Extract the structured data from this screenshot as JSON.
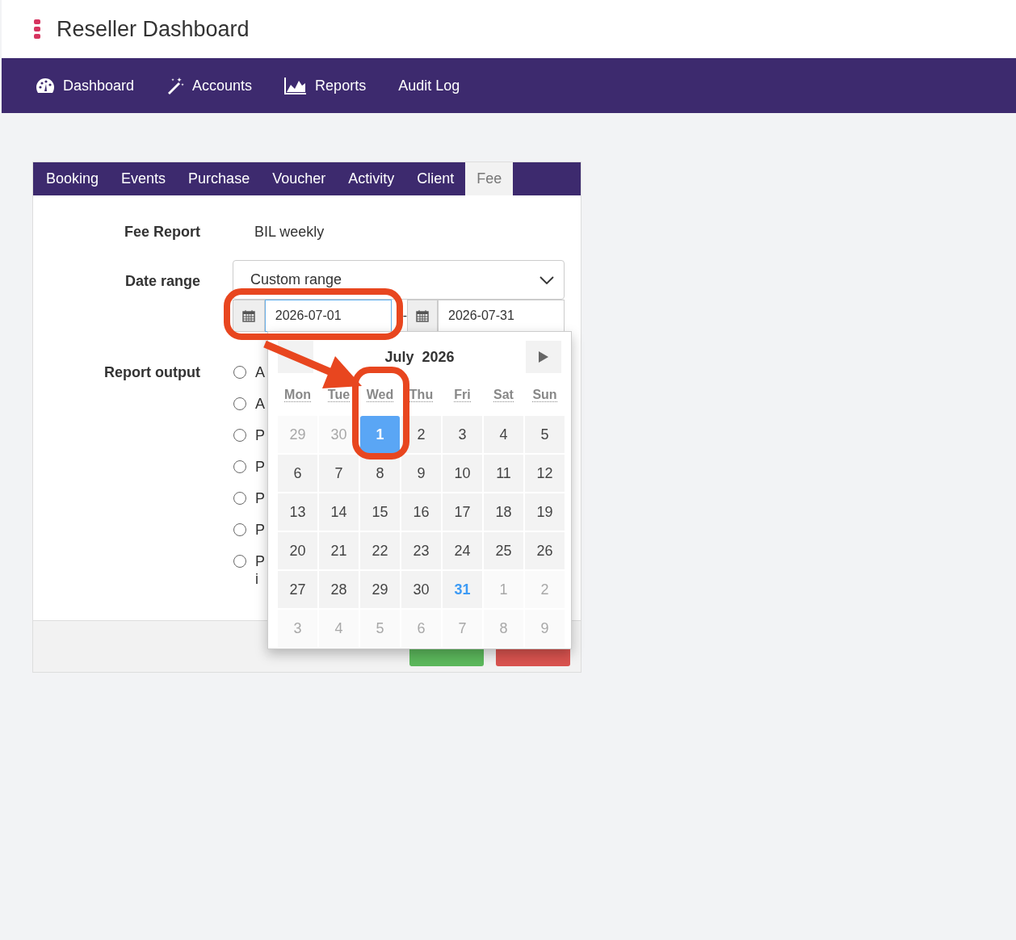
{
  "app": {
    "title": "Reseller Dashboard"
  },
  "nav": [
    {
      "label": "Dashboard"
    },
    {
      "label": "Accounts"
    },
    {
      "label": "Reports"
    },
    {
      "label": "Audit Log"
    }
  ],
  "tabs": [
    {
      "label": "Booking",
      "selected": false
    },
    {
      "label": "Events",
      "selected": false
    },
    {
      "label": "Purchase",
      "selected": false
    },
    {
      "label": "Voucher",
      "selected": false
    },
    {
      "label": "Activity",
      "selected": false
    },
    {
      "label": "Client",
      "selected": false
    },
    {
      "label": "Fee",
      "selected": true
    }
  ],
  "form": {
    "fee_report": {
      "label": "Fee Report",
      "value": "BIL weekly"
    },
    "date_range": {
      "label": "Date range",
      "value": "Custom range",
      "start": "2026-07-01",
      "start_focused": true,
      "separator": "-",
      "end": "2026-07-31"
    },
    "report_output": {
      "label": "Report output",
      "options": [
        {
          "label": "A",
          "selected": false
        },
        {
          "label": "A",
          "selected": false
        },
        {
          "label": "P",
          "selected": false
        },
        {
          "label": "P",
          "selected": false
        },
        {
          "label": "P",
          "selected": false
        },
        {
          "label": "P",
          "selected": false
        },
        {
          "label": "P\ni",
          "selected": false
        }
      ]
    }
  },
  "footer_buttons": [
    {
      "kind": "success"
    },
    {
      "kind": "danger"
    }
  ],
  "calendar": {
    "title": "July  2026",
    "weekdays": [
      "Mon",
      "Tue",
      "Wed",
      "Thu",
      "Fri",
      "Sat",
      "Sun"
    ],
    "weeks": [
      [
        {
          "day": "29",
          "outside": true,
          "selected": false,
          "today": false
        },
        {
          "day": "30",
          "outside": true,
          "selected": false,
          "today": false
        },
        {
          "day": "1",
          "outside": false,
          "selected": true,
          "today": false
        },
        {
          "day": "2",
          "outside": false,
          "selected": false,
          "today": false
        },
        {
          "day": "3",
          "outside": false,
          "selected": false,
          "today": false
        },
        {
          "day": "4",
          "outside": false,
          "selected": false,
          "today": false
        },
        {
          "day": "5",
          "outside": false,
          "selected": false,
          "today": false
        }
      ],
      [
        {
          "day": "6",
          "outside": false,
          "selected": false,
          "today": false
        },
        {
          "day": "7",
          "outside": false,
          "selected": false,
          "today": false
        },
        {
          "day": "8",
          "outside": false,
          "selected": false,
          "today": false
        },
        {
          "day": "9",
          "outside": false,
          "selected": false,
          "today": false
        },
        {
          "day": "10",
          "outside": false,
          "selected": false,
          "today": false
        },
        {
          "day": "11",
          "outside": false,
          "selected": false,
          "today": false
        },
        {
          "day": "12",
          "outside": false,
          "selected": false,
          "today": false
        }
      ],
      [
        {
          "day": "13",
          "outside": false,
          "selected": false,
          "today": false
        },
        {
          "day": "14",
          "outside": false,
          "selected": false,
          "today": false
        },
        {
          "day": "15",
          "outside": false,
          "selected": false,
          "today": false
        },
        {
          "day": "16",
          "outside": false,
          "selected": false,
          "today": false
        },
        {
          "day": "17",
          "outside": false,
          "selected": false,
          "today": false
        },
        {
          "day": "18",
          "outside": false,
          "selected": false,
          "today": false
        },
        {
          "day": "19",
          "outside": false,
          "selected": false,
          "today": false
        }
      ],
      [
        {
          "day": "20",
          "outside": false,
          "selected": false,
          "today": false
        },
        {
          "day": "21",
          "outside": false,
          "selected": false,
          "today": false
        },
        {
          "day": "22",
          "outside": false,
          "selected": false,
          "today": false
        },
        {
          "day": "23",
          "outside": false,
          "selected": false,
          "today": false
        },
        {
          "day": "24",
          "outside": false,
          "selected": false,
          "today": false
        },
        {
          "day": "25",
          "outside": false,
          "selected": false,
          "today": false
        },
        {
          "day": "26",
          "outside": false,
          "selected": false,
          "today": false
        }
      ],
      [
        {
          "day": "27",
          "outside": false,
          "selected": false,
          "today": false
        },
        {
          "day": "28",
          "outside": false,
          "selected": false,
          "today": false
        },
        {
          "day": "29",
          "outside": false,
          "selected": false,
          "today": false
        },
        {
          "day": "30",
          "outside": false,
          "selected": false,
          "today": false
        },
        {
          "day": "31",
          "outside": false,
          "selected": false,
          "today": true
        },
        {
          "day": "1",
          "outside": true,
          "selected": false,
          "today": false
        },
        {
          "day": "2",
          "outside": true,
          "selected": false,
          "today": false
        }
      ],
      [
        {
          "day": "3",
          "outside": true,
          "selected": false,
          "today": false
        },
        {
          "day": "4",
          "outside": true,
          "selected": false,
          "today": false
        },
        {
          "day": "5",
          "outside": true,
          "selected": false,
          "today": false
        },
        {
          "day": "6",
          "outside": true,
          "selected": false,
          "today": false
        },
        {
          "day": "7",
          "outside": true,
          "selected": false,
          "today": false
        },
        {
          "day": "8",
          "outside": true,
          "selected": false,
          "today": false
        },
        {
          "day": "9",
          "outside": true,
          "selected": false,
          "today": false
        }
      ]
    ]
  },
  "annotations": [
    {
      "kind": "box",
      "color": "#e8461f"
    },
    {
      "kind": "box",
      "color": "#e8461f"
    },
    {
      "kind": "arrow",
      "color": "#e8461f"
    }
  ]
}
